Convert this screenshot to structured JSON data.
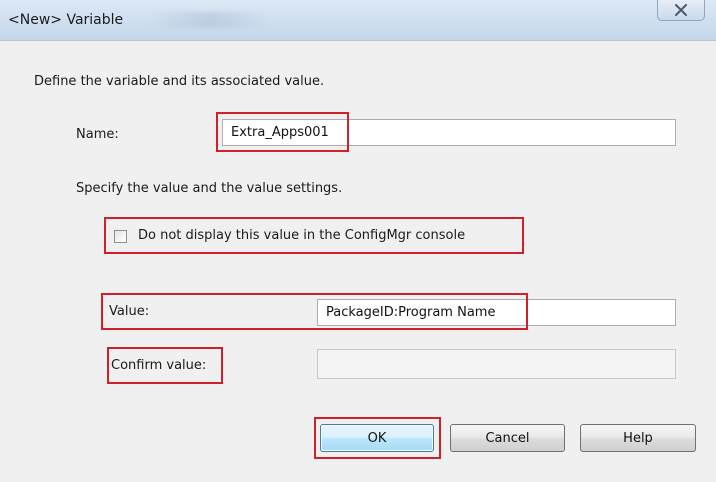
{
  "window": {
    "title": "<New> Variable",
    "accent_color": "#d0202a"
  },
  "dialog": {
    "intro_text": "Define the variable and its associated value.",
    "name_label": "Name:",
    "name_value": "Extra_Apps001",
    "settings_text": "Specify the value and the value settings.",
    "checkbox_label": "Do not display this value in the ConfigMgr console",
    "checkbox_checked": false,
    "value_label": "Value:",
    "value_value": "PackageID:Program Name",
    "confirm_label": "Confirm value:",
    "confirm_value": ""
  },
  "buttons": {
    "ok": "OK",
    "cancel": "Cancel",
    "help": "Help"
  },
  "icons": {
    "close": "close-icon"
  }
}
